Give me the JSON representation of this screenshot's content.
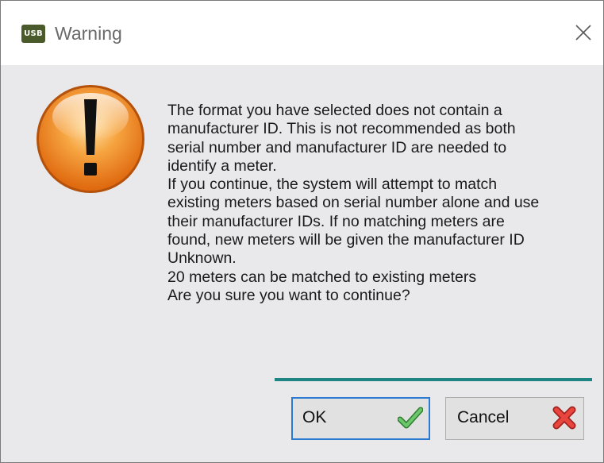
{
  "window": {
    "title": "Warning",
    "app_icon_text": "USB",
    "close_glyph": "×"
  },
  "message": {
    "text": "The format you have selected does not contain a\nmanufacturer ID. This is not recommended as both\nserial number and manufacturer ID are needed to\nidentify a meter.\nIf you continue, the system will attempt to match\nexisting meters based on serial number alone and use\ntheir manufacturer IDs. If no matching meters are\nfound, new meters will be given the manufacturer ID\nUnknown.\n20 meters can be matched to existing meters\nAre you sure you want to continue?"
  },
  "buttons": {
    "ok_label": "OK",
    "cancel_label": "Cancel"
  },
  "icons": {
    "warning": "warning-exclamation-icon",
    "ok": "green-check-icon",
    "cancel": "red-x-icon",
    "close": "close-icon"
  },
  "colors": {
    "accent_line": "#1e8484",
    "focus_border": "#2a7ad1",
    "warning_orange": "#f07d1a",
    "check_green": "#3aa63a",
    "cancel_red": "#d9302b"
  }
}
